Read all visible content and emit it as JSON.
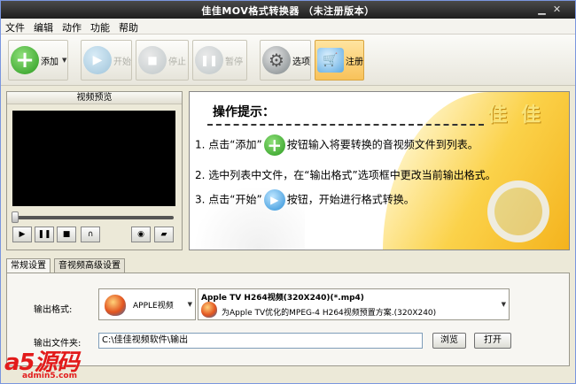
{
  "window": {
    "title": "佳佳MOV格式转换器 （未注册版本）"
  },
  "menu": [
    "文件",
    "编辑",
    "动作",
    "功能",
    "帮助"
  ],
  "toolbar": {
    "add": "添加",
    "start": "开始",
    "stop": "停止",
    "pause": "暂停",
    "options": "选项",
    "register": "注册"
  },
  "preview": {
    "title": "视频预览"
  },
  "tips": {
    "heading": "操作提示：",
    "brand": "佳 佳",
    "step1_a": "1. 点击“添加”",
    "step1_b": "按钮输入将要转换的音视频文件到列表。",
    "step2": "2. 选中列表中文件，在“输出格式”选项框中更改当前输出格式。",
    "step3_a": "3. 点击“开始”",
    "step3_b": "按钮，开始进行格式转换。"
  },
  "tabs": [
    "常规设置",
    "音视频高级设置"
  ],
  "settings": {
    "output_format_label": "输出格式:",
    "category": "APPLE视频",
    "format_title": "Apple TV H264视频(320X240)(*.mp4)",
    "format_desc": "为Apple TV优化的MPEG-4 H264视频预置方案.(320X240)",
    "output_folder_label": "输出文件夹:",
    "output_folder": "C:\\佳佳视频软件\\输出",
    "browse": "浏览",
    "open": "打开"
  },
  "watermark": {
    "brand": "a5源码",
    "site": "admin5.com"
  },
  "colors": {
    "titlebar": "#2a2a2a",
    "accent": "#f8c25a",
    "add_green": "#2b9a1f",
    "play_blue": "#2c8fd8"
  }
}
